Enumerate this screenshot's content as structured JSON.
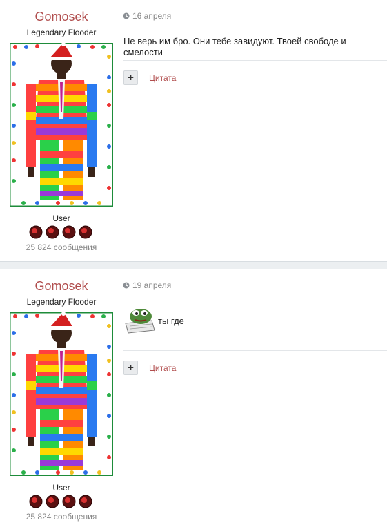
{
  "posts": [
    {
      "author": {
        "name": "Gomosek",
        "title": "Legendary Flooder",
        "group": "User",
        "post_count": "25 824 сообщения"
      },
      "date": "16 апреля",
      "text": "Не верь им бро. Они тебе завидуют. Твоей свободе и смелости",
      "quote_label": "Цитата",
      "quote_button_icon": "plus-icon"
    },
    {
      "author": {
        "name": "Gomosek",
        "title": "Legendary Flooder",
        "group": "User",
        "post_count": "25 824 сообщения"
      },
      "date": "19 апреля",
      "text": "ты где",
      "quote_label": "Цитата",
      "quote_button_icon": "plus-icon",
      "sticker_icon": "frog-sticker-icon"
    }
  ],
  "colors": {
    "author_name": "#b14e4e",
    "quote_link": "#b14e4e",
    "separator": "#eceff1",
    "muted": "#888888"
  }
}
